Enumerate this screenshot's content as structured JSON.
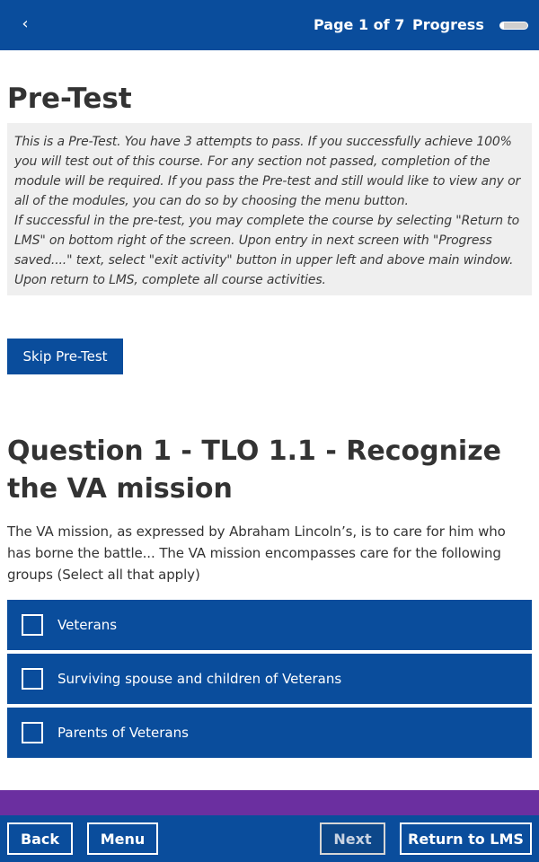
{
  "header": {
    "back_icon": "chevron-left-icon",
    "back_glyph": "‹",
    "page_indicator": "Page 1 of 7",
    "progress_label": "Progress",
    "progress_fraction": 0.14
  },
  "main": {
    "title": "Pre-Test",
    "intro_paragraphs": [
      "This is a Pre-Test. You have 3 attempts to pass. If you successfully achieve 100% you will test out of this course. For any section not passed, completion of the module will be required. If you pass the Pre-test and still would like to view any or all of the modules, you can do so by choosing the menu button.",
      "If successful in the pre-test, you may complete the course by selecting \"Return to LMS\" on bottom right of the screen. Upon entry in next screen with \"Progress saved....\" text, select \"exit activity\" button in upper left and above main window. Upon return to LMS, complete all course activities."
    ],
    "skip_button": "Skip Pre-Test"
  },
  "question": {
    "title": "Question 1 - TLO 1.1 - Recognize the VA mission",
    "text": "The VA mission, as expressed by Abraham Lincoln’s, is to care for him who has borne the battle... The VA mission encompasses care for the following groups (Select all that apply)",
    "options": [
      {
        "label": "Veterans",
        "checked": false
      },
      {
        "label": "Surviving spouse and children of Veterans",
        "checked": false
      },
      {
        "label": "Parents of Veterans",
        "checked": false
      }
    ]
  },
  "footer": {
    "back": "Back",
    "menu": "Menu",
    "next": "Next",
    "next_disabled": true,
    "return": "Return to LMS"
  },
  "colors": {
    "primary_blue": "#0a4d9c",
    "accent_purple": "#6b2fa0",
    "intro_background": "#efefef"
  }
}
